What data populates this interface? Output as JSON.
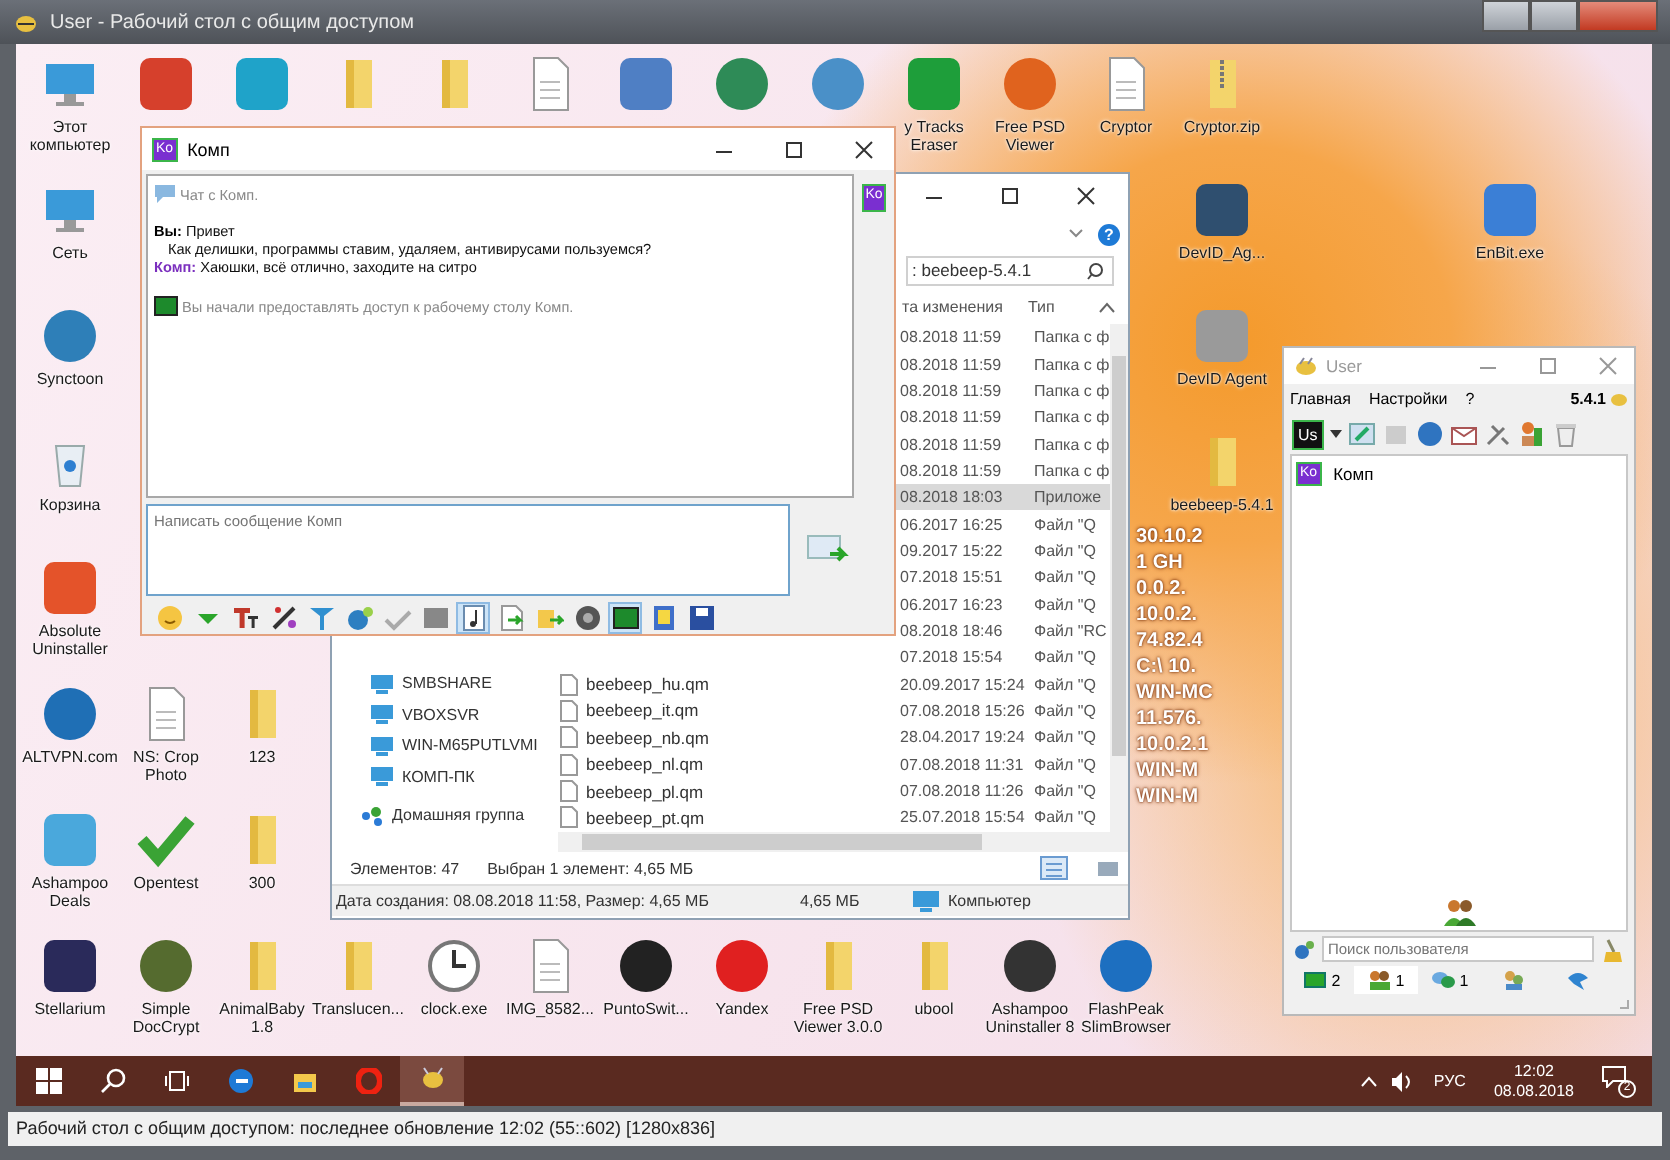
{
  "window": {
    "title": "User - Рабочий стол с общим доступом"
  },
  "desktop_icons": [
    {
      "kind": "monitor",
      "label": "Этот компьютер"
    },
    {
      "kind": "app",
      "color": "#d6402c"
    },
    {
      "kind": "app",
      "color": "#1fa3c9"
    },
    {
      "kind": "folder"
    },
    {
      "kind": "folder"
    },
    {
      "kind": "document"
    },
    {
      "kind": "app",
      "color": "#4f7fc4"
    },
    {
      "kind": "round",
      "color": "#2e8b57"
    },
    {
      "kind": "round",
      "color": "#4a90c8"
    },
    {
      "kind": "app",
      "color": "#1e9e3a",
      "label": "y Tracks Eraser"
    },
    {
      "kind": "round",
      "color": "#e0631e",
      "label": "Free PSD Viewer"
    },
    {
      "kind": "document",
      "label": "Cryptor"
    },
    {
      "kind": "zip",
      "label": "Cryptor.zip"
    },
    {
      "kind": "monitor",
      "label": "Сеть"
    },
    {
      "kind": "app",
      "color": "#2f4f6f",
      "label": "DevID_Ag..."
    },
    {
      "kind": "app",
      "color": "#3b7fd6",
      "label": "EnBit.exe"
    },
    {
      "kind": "round",
      "color": "#2e7fb8",
      "label": "Synctoon"
    },
    {
      "kind": "app",
      "color": "#9a9a9a",
      "label": "DevID Agent"
    },
    {
      "kind": "bin",
      "label": "Корзина"
    },
    {
      "kind": "folder",
      "label": "beebeep-5.4.1"
    },
    {
      "kind": "app",
      "color": "#e4532a",
      "label": "Absolute Uninstaller"
    },
    {
      "kind": "round",
      "color": "#1f6fb5",
      "label": "ALTVPN.com"
    },
    {
      "kind": "document",
      "label": "NS: Crop Photo"
    },
    {
      "kind": "folder",
      "label": "123"
    },
    {
      "kind": "app",
      "color": "#4aa8dc",
      "label": "Ashampoo Deals"
    },
    {
      "kind": "check",
      "label": "Opentest"
    },
    {
      "kind": "folder",
      "label": "300"
    },
    {
      "kind": "app",
      "color": "#2a2a5a",
      "label": "Stellarium"
    },
    {
      "kind": "round",
      "color": "#556b2f",
      "label": "Simple DocCrypt"
    },
    {
      "kind": "folder",
      "label": "AnimalBaby 1.8"
    },
    {
      "kind": "folder",
      "label": "Translucen..."
    },
    {
      "kind": "clock",
      "label": "clock.exe"
    },
    {
      "kind": "document",
      "label": "IMG_8582..."
    },
    {
      "kind": "round",
      "color": "#222222",
      "label": "PuntoSwit..."
    },
    {
      "kind": "round",
      "color": "#e02020",
      "label": "Yandex"
    },
    {
      "kind": "folder",
      "label": "Free PSD Viewer 3.0.0"
    },
    {
      "kind": "folder",
      "label": "ubool"
    },
    {
      "kind": "round",
      "color": "#333333",
      "label": "Ashampoo Uninstaller 8"
    },
    {
      "kind": "round",
      "color": "#1d6fc0",
      "label": "FlashPeak SlimBrowser"
    }
  ],
  "system_info": [
    "30.10.2",
    "1 GH",
    "0.0.2.",
    "10.0.2.",
    "74.82.4",
    "C:\\ 10.",
    "WIN-MC",
    "11.576.",
    "10.0.2.1",
    "WIN-M",
    "WIN-M"
  ],
  "explorer": {
    "search_value": ": beebeep-5.4.1",
    "help": "?",
    "columns": [
      {
        "label": "та изменения"
      },
      {
        "label": "Тип"
      }
    ],
    "rows": [
      {
        "date": "08.2018 11:59",
        "type": "Папка с ф",
        "selected": false
      },
      {
        "date": "08.2018 11:59",
        "type": "Папка с ф",
        "selected": false
      },
      {
        "date": "08.2018 11:59",
        "type": "Папка с ф",
        "selected": false
      },
      {
        "date": "08.2018 11:59",
        "type": "Папка с ф",
        "selected": false
      },
      {
        "date": "08.2018 11:59",
        "type": "Папка с ф",
        "selected": false
      },
      {
        "date": "08.2018 11:59",
        "type": "Папка с ф",
        "selected": false
      },
      {
        "date": "08.2018 18:03",
        "type": "Приложе",
        "selected": true
      },
      {
        "date": "06.2017 16:25",
        "type": "Файл \"Q",
        "selected": false
      },
      {
        "date": "09.2017 15:22",
        "type": "Файл \"Q",
        "selected": false
      },
      {
        "date": "07.2018 15:51",
        "type": "Файл \"Q",
        "selected": false
      },
      {
        "date": "06.2017 16:23",
        "type": "Файл \"Q",
        "selected": false
      },
      {
        "date": "08.2018 18:46",
        "type": "Файл \"RC",
        "selected": false
      },
      {
        "date": "07.2018 15:54",
        "type": "Файл \"Q",
        "selected": false
      },
      {
        "name": "beebeep_hu.qm",
        "date": "20.09.2017 15:24",
        "type": "Файл \"Q",
        "selected": false
      },
      {
        "name": "beebeep_it.qm",
        "date": "07.08.2018 15:26",
        "type": "Файл \"Q",
        "selected": false
      },
      {
        "name": "beebeep_nb.qm",
        "date": "28.04.2017 19:24",
        "type": "Файл \"Q",
        "selected": false
      },
      {
        "name": "beebeep_nl.qm",
        "date": "07.08.2018 11:31",
        "type": "Файл \"Q",
        "selected": false
      },
      {
        "name": "beebeep_pl.qm",
        "date": "07.08.2018 11:26",
        "type": "Файл \"Q",
        "selected": false
      },
      {
        "name": "beebeep_pt.qm",
        "date": "25.07.2018 15:54",
        "type": "Файл \"Q",
        "selected": false
      }
    ],
    "nav": [
      {
        "kind": "computer",
        "label": "SMBSHARE"
      },
      {
        "kind": "computer",
        "label": "VBOXSVR"
      },
      {
        "kind": "computer",
        "label": "WIN-M65PUTLVMI"
      },
      {
        "kind": "computer",
        "label": "КОМП-ПК"
      },
      {
        "kind": "homegroup",
        "label": "Домашняя группа"
      }
    ],
    "status": {
      "count": "Элементов: 47",
      "selection": "Выбран 1 элемент: 4,65 МБ"
    },
    "details": {
      "info": "Дата создания: 08.08.2018 11:58, Размер: 4,65 МБ",
      "size": "4,65 МБ",
      "location": "Компьютер"
    }
  },
  "chat_window": {
    "title": "Комп",
    "avatar": "Ko",
    "side_avatar": "Ko",
    "messages": [
      {
        "kind": "notice",
        "text": "Чат с Комп."
      },
      {
        "kind": "message",
        "sender": "Вы:",
        "color": "#000000",
        "lines": [
          "Привет",
          "Как делишки, программы ставим, удаляем, антивирусами пользуемся?"
        ]
      },
      {
        "kind": "message",
        "sender": "Комп:",
        "color": "#7b2fbe",
        "lines": [
          "Хаюшки, всё отлично, заходите на ситро"
        ]
      },
      {
        "kind": "system",
        "text": "Вы начали предоставлять доступ к рабочему столу Комп."
      }
    ],
    "input": {
      "placeholder": "Написать сообщение Комп"
    },
    "toolbar": [
      {
        "kind": "smiley",
        "on": false
      },
      {
        "kind": "arrow",
        "on": false
      },
      {
        "kind": "font",
        "on": false
      },
      {
        "kind": "pen",
        "on": false
      },
      {
        "kind": "funnel",
        "on": false
      },
      {
        "kind": "gear",
        "on": false
      },
      {
        "kind": "spell",
        "on": false
      },
      {
        "kind": "image",
        "on": false
      },
      {
        "kind": "note",
        "on": true
      },
      {
        "kind": "file",
        "on": false
      },
      {
        "kind": "folder",
        "on": false
      },
      {
        "kind": "camera",
        "on": false
      },
      {
        "kind": "screen",
        "on": true
      },
      {
        "kind": "notepad",
        "on": false
      },
      {
        "kind": "save",
        "on": false
      }
    ]
  },
  "user_window": {
    "title": "User",
    "menu": [
      {
        "label": "Главная"
      },
      {
        "label": "Настройки"
      },
      {
        "label": "?"
      }
    ],
    "version": "5.4.1",
    "avatar": "Us",
    "users": [
      {
        "avatar": "Ko",
        "name": "Комп"
      }
    ],
    "search": {
      "placeholder": "Поиск пользователя"
    },
    "tabs": [
      {
        "kind": "screen",
        "count": "2",
        "selected": false
      },
      {
        "kind": "people",
        "count": "1",
        "selected": true
      },
      {
        "kind": "chat",
        "count": "1",
        "selected": false
      },
      {
        "kind": "group",
        "selected": false
      },
      {
        "kind": "bird",
        "selected": false
      }
    ]
  },
  "taskbar": {
    "buttons": [
      {
        "kind": "windows",
        "selected": false
      },
      {
        "kind": "search",
        "selected": false
      },
      {
        "kind": "taskview",
        "selected": false
      },
      {
        "kind": "edge",
        "selected": false
      },
      {
        "kind": "folder",
        "selected": false
      },
      {
        "kind": "opera",
        "selected": false
      },
      {
        "kind": "bee",
        "selected": true
      }
    ],
    "language": "РУС",
    "time": "12:02",
    "date": "08.08.2018",
    "notifications": "2"
  },
  "status_bar": "Рабочий стол с общим доступом: последнее обновление 12:02 (55::602) [1280x836]"
}
